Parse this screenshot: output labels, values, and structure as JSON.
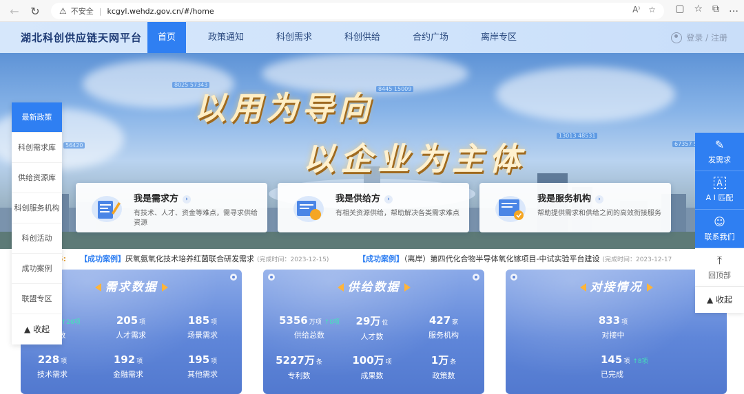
{
  "browser": {
    "back": "←",
    "forward": "→",
    "reload": "↻",
    "warning": "⚠",
    "insecure_label": "不安全",
    "separator": "|",
    "url": "kcgyl.wehdz.gov.cn/#/home",
    "read_aloud": "A⁾",
    "favorite": "☆",
    "tools": [
      "▢",
      "☆",
      "⧉",
      "…"
    ]
  },
  "header": {
    "logo": "湖北科创供应链天网平台",
    "nav": [
      "首页",
      "政策通知",
      "科创需求",
      "科创供给",
      "合约广场",
      "离岸专区"
    ],
    "login": "登录 / 注册"
  },
  "banner": {
    "slogan_line1": "以用为导向",
    "slogan_line2": "以企业为主体",
    "number_tags": [
      "8025 57343",
      "8445 15009",
      "13013 48531",
      "67357 56",
      "56420"
    ]
  },
  "role_cards": [
    {
      "title": "我是需求方",
      "desc": "有技术、人才、资金等难点，需寻求供给资源"
    },
    {
      "title": "我是供给方",
      "desc": "有相关资源供给，帮助解决各类需求难点"
    },
    {
      "title": "我是服务机构",
      "desc": "帮助提供需求和供给之间的高效衔接服务"
    }
  ],
  "left_menu": {
    "items": [
      "最新政策",
      "科创需求库",
      "供给资源库",
      "科创服务机构",
      "科创活动",
      "成功案例",
      "联盟专区"
    ],
    "collapse": "▲ 收起"
  },
  "right_bar": {
    "items": [
      {
        "icon": "✎",
        "label": "发需求"
      },
      {
        "icon": "A",
        "label": "A I 匹配"
      },
      {
        "icon": "☺",
        "label": "联系我们"
      }
    ],
    "top": {
      "icon": "⤒",
      "label": "回顶部"
    },
    "collapse": "▲ 收起"
  },
  "ticker": {
    "lead": "5:",
    "cases": [
      {
        "tag": "【成功案例】",
        "text": "厌氧氨氧化技术培养红菌联合研发需求",
        "date": "(完成时间：2023-12-15)"
      },
      {
        "tag": "【成功案例】",
        "text": "（离岸）第四代化合物半导体氧化镓项目-中试实验平台建设",
        "date": "(完成时间：2023-12-17"
      }
    ]
  },
  "panels": [
    {
      "title": "需求数据",
      "stats": [
        {
          "value": "5",
          "unit": "项",
          "delta": "↑26项",
          "label": "数"
        },
        {
          "value": "205",
          "unit": "项",
          "delta": "",
          "label": "人才需求"
        },
        {
          "value": "185",
          "unit": "项",
          "delta": "",
          "label": "场景需求"
        },
        {
          "value": "228",
          "unit": "项",
          "delta": "",
          "label": "技术需求"
        },
        {
          "value": "192",
          "unit": "项",
          "delta": "",
          "label": "金融需求"
        },
        {
          "value": "195",
          "unit": "项",
          "delta": "",
          "label": "其他需求"
        }
      ]
    },
    {
      "title": "供给数据",
      "stats": [
        {
          "value": "5356",
          "unit": "万项",
          "delta": "↑0项",
          "label": "供给总数"
        },
        {
          "value": "29万",
          "unit": "位",
          "delta": "",
          "label": "人才数"
        },
        {
          "value": "427",
          "unit": "家",
          "delta": "",
          "label": "服务机构"
        },
        {
          "value": "5227万",
          "unit": "条",
          "delta": "",
          "label": "专利数"
        },
        {
          "value": "100万",
          "unit": "项",
          "delta": "",
          "label": "成果数"
        },
        {
          "value": "1万",
          "unit": "条",
          "delta": "",
          "label": "政策数"
        }
      ]
    },
    {
      "title": "对接情况",
      "stats": [
        {
          "value": "833",
          "unit": "项",
          "delta": "",
          "label": "对接中"
        },
        {
          "value": "145",
          "unit": "项",
          "delta": "↑8项",
          "label": "已完成"
        }
      ]
    }
  ],
  "colors": {
    "primary": "#2f7ff2",
    "accent": "#ffb43a",
    "delta": "#42e6b8",
    "case_tag": "#2f7ff2"
  }
}
